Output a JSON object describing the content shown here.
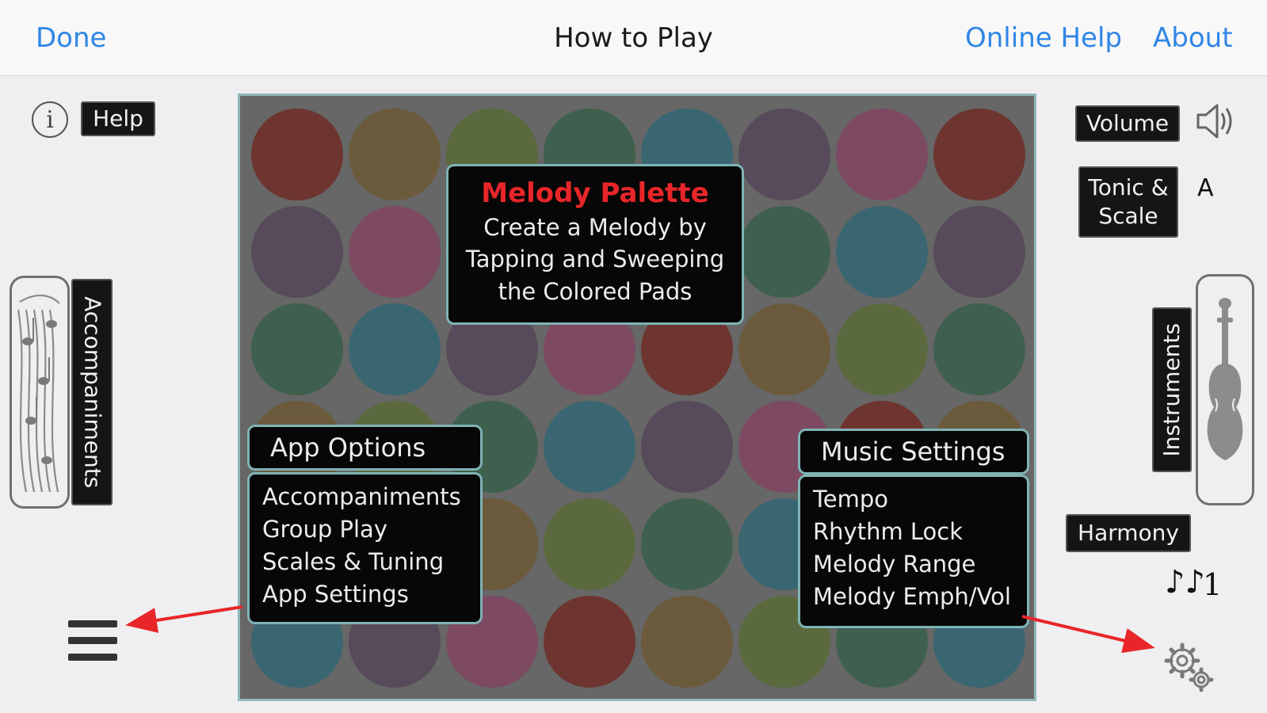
{
  "nav": {
    "done": "Done",
    "title": "How to Play",
    "online_help": "Online Help",
    "about": "About"
  },
  "left": {
    "help": "Help",
    "accompaniments": "Accompaniments"
  },
  "right": {
    "volume": "Volume",
    "tonic_scale_line1": "Tonic &",
    "tonic_scale_line2": "Scale",
    "tonic_value": "A",
    "instruments": "Instruments",
    "harmony": "Harmony",
    "harmony_value": "1"
  },
  "melody_palette": {
    "title": "Melody Palette",
    "line1": "Create a Melody by",
    "line2": "Tapping and Sweeping",
    "line3": "the Colored Pads"
  },
  "app_options": {
    "header": "App Options",
    "items": [
      "Accompaniments",
      "Group Play",
      "Scales & Tuning",
      "App Settings"
    ]
  },
  "music_settings": {
    "header": "Music Settings",
    "items": [
      "Tempo",
      "Rhythm Lock",
      "Melody Range",
      "Melody Emph/Vol"
    ]
  },
  "colors": {
    "accent_blue": "#2f86e6",
    "callout_title_red": "#e8262a",
    "arrow_red": "#e8262a",
    "board_bg": "#666766",
    "pad_colors": {
      "red": "#6e3530",
      "brown": "#6b5a3c",
      "olive": "#5b6a3e",
      "green": "#3f604e",
      "teal": "#3a6672",
      "plum": "#574a5a",
      "magenta": "#7d4a62"
    }
  },
  "pad_grid": [
    [
      "red",
      "brown",
      "olive",
      "green",
      "teal",
      "plum",
      "magenta",
      "red"
    ],
    [
      "plum",
      "magenta",
      "red",
      "brown",
      "olive",
      "green",
      "teal",
      "plum"
    ],
    [
      "green",
      "teal",
      "plum",
      "magenta",
      "red",
      "brown",
      "olive",
      "green"
    ],
    [
      "brown",
      "olive",
      "green",
      "teal",
      "plum",
      "magenta",
      "red",
      "brown"
    ],
    [
      "magenta",
      "red",
      "brown",
      "olive",
      "green",
      "teal",
      "plum",
      "magenta"
    ],
    [
      "teal",
      "plum",
      "magenta",
      "red",
      "brown",
      "olive",
      "green",
      "teal"
    ]
  ]
}
